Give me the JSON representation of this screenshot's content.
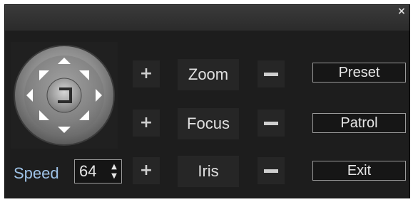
{
  "window": {
    "close_symbol": "×"
  },
  "labels": {
    "zoom": "Zoom",
    "focus": "Focus",
    "iris": "Iris"
  },
  "buttons": {
    "preset": "Preset",
    "patrol": "Patrol",
    "exit": "Exit"
  },
  "speed": {
    "label": "Speed",
    "value": "64"
  },
  "icons": {
    "plus": "+",
    "pan_joystick": "ptz-joystick-icon",
    "center": "center-rotate-icon"
  },
  "colors": {
    "panel": "#1d1d1d",
    "speed_label": "#9ec2e6",
    "button_text": "#e6e6e6"
  }
}
